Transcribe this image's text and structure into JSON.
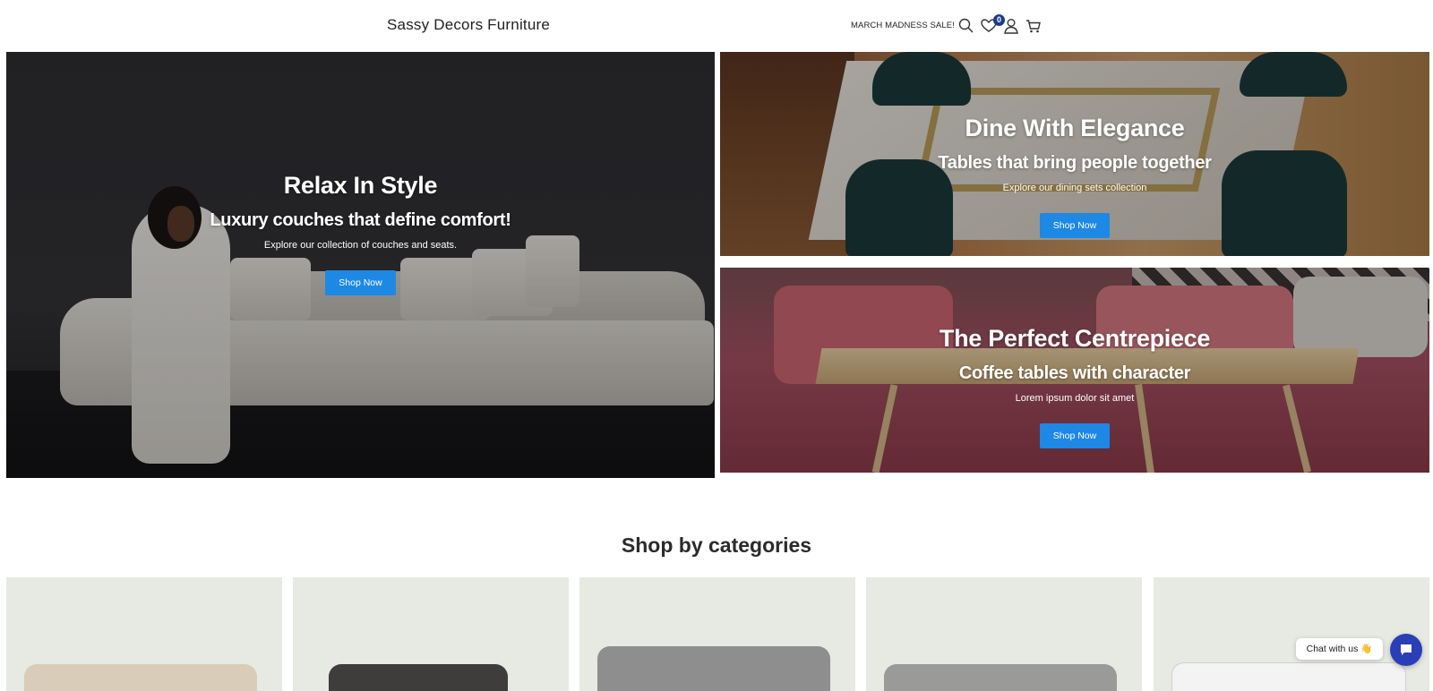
{
  "header": {
    "brand": "Sassy Decors Furniture",
    "promo": "MARCH MADNESS SALE!",
    "wishlist_count": "0",
    "icons": [
      "search-icon",
      "heart-icon",
      "user-icon",
      "cart-icon"
    ]
  },
  "banners": {
    "main": {
      "title": "Relax In Style",
      "subtitle": "Luxury couches that define comfort!",
      "description": "Explore our collection of couches and seats.",
      "button": "Shop Now"
    },
    "dining": {
      "title": "Dine With Elegance",
      "subtitle": "Tables that bring people together",
      "description": "Explore our dining sets collection",
      "button": "Shop Now"
    },
    "coffee": {
      "title": "The Perfect Centrepiece",
      "subtitle": "Coffee tables with character",
      "description": "Lorem ipsum dolor sit amet",
      "button": "Shop Now"
    }
  },
  "slider": {
    "total": 2,
    "active": 1
  },
  "categories_section": {
    "title": "Shop by categories"
  },
  "chat": {
    "label": "Chat with us 👋"
  },
  "colors": {
    "accent": "#1e88e5",
    "chat": "#2a3fb6",
    "category_bg": "#e7e9e3"
  }
}
